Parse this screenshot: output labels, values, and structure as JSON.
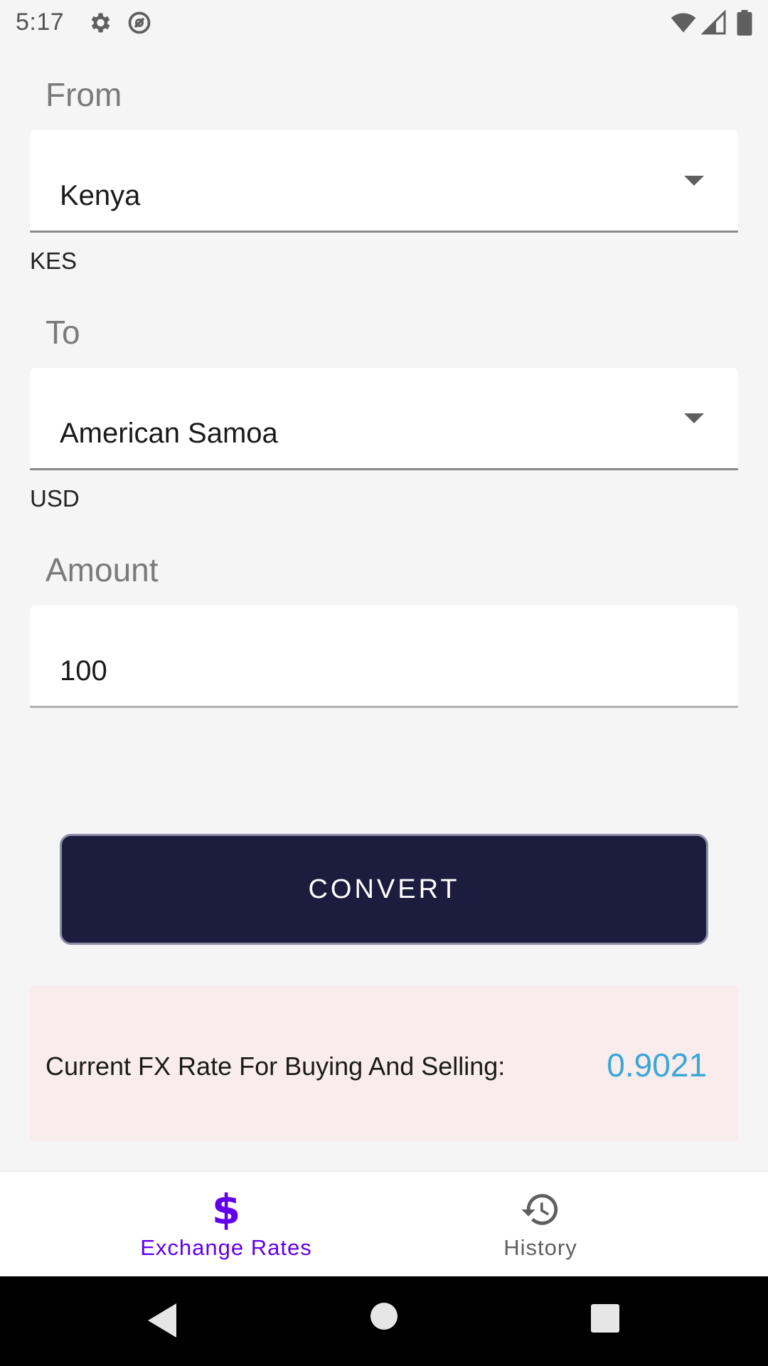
{
  "status_bar": {
    "time": "5:17",
    "icons": [
      "settings-gear-icon",
      "do-not-disturb-icon",
      "wifi-icon",
      "signal-icon",
      "battery-icon"
    ]
  },
  "from": {
    "label": "From",
    "selected": "Kenya",
    "currency": "KES"
  },
  "to": {
    "label": "To",
    "selected": "American Samoa",
    "currency": "USD"
  },
  "amount": {
    "label": "Amount",
    "value": "100"
  },
  "convert_label": "CONVERT",
  "rate": {
    "label": "Current FX Rate For Buying And Selling:",
    "value": "0.9021"
  },
  "bottom_nav": {
    "items": [
      {
        "label": "Exchange Rates",
        "icon": "dollar-icon",
        "active": true
      },
      {
        "label": "History",
        "icon": "history-icon",
        "active": false
      }
    ]
  },
  "colors": {
    "accent": "#6200ee",
    "button_bg": "#1c1c3f",
    "rate_value": "#3aa7d8",
    "rate_card_bg": "#f9eced",
    "inactive_nav": "#5f5f5f"
  }
}
